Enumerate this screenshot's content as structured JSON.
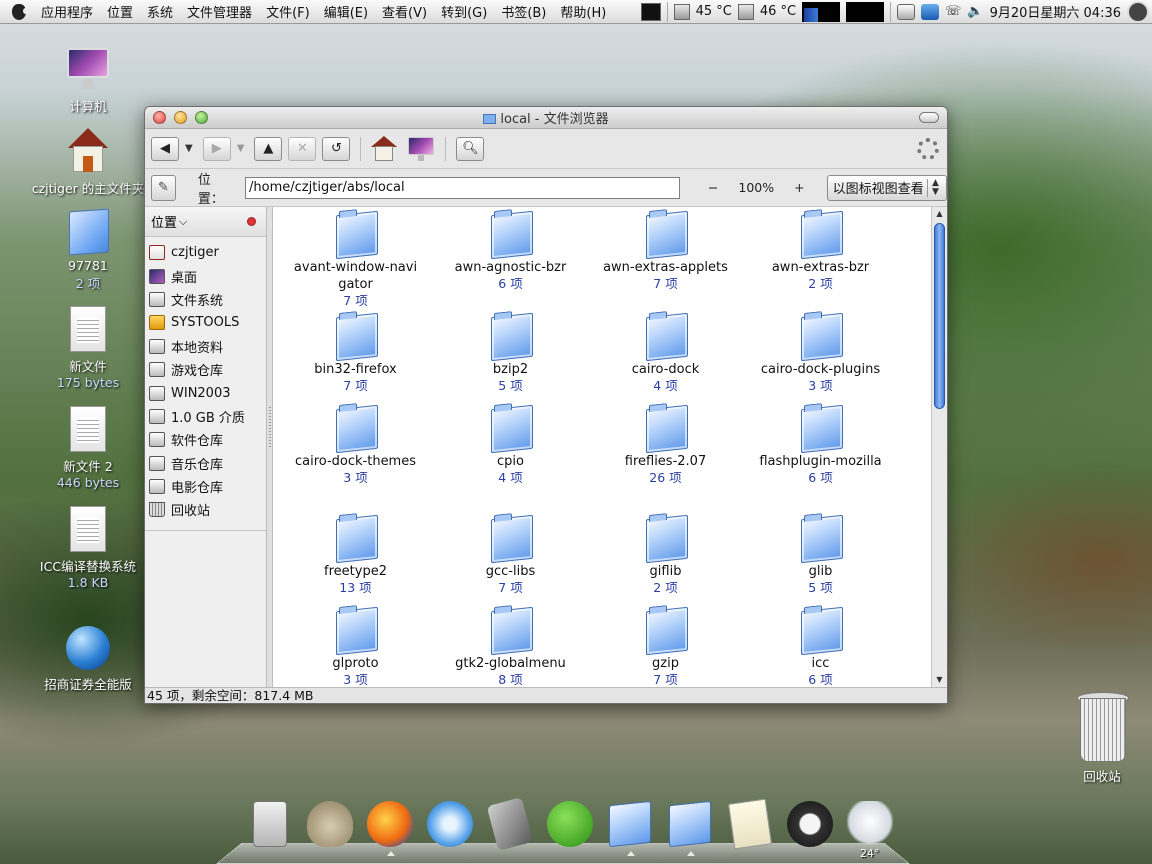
{
  "top_panel": {
    "menus": [
      "应用程序",
      "位置",
      "系统"
    ],
    "file_manager_menus": [
      "文件管理器",
      "文件(F)",
      "编辑(E)",
      "查看(V)",
      "转到(G)",
      "书签(B)",
      "帮助(H)"
    ],
    "temp1": "45 °C",
    "temp2": "46 °C",
    "clock": "9月20日星期六 04:36"
  },
  "desktop_icons": [
    {
      "label": "计算机",
      "sub": ""
    },
    {
      "label": "czjtiger 的主文件夹",
      "sub": ""
    },
    {
      "label": "97781",
      "sub": "2 项"
    },
    {
      "label": "新文件",
      "sub": "175 bytes"
    },
    {
      "label": "新文件 2",
      "sub": "446 bytes"
    },
    {
      "label": "ICC编译替换系统",
      "sub": "1.8 KB"
    },
    {
      "label": "招商证券全能版",
      "sub": ""
    },
    {
      "label": "回收站",
      "sub": ""
    }
  ],
  "window": {
    "title": "local - 文件浏览器",
    "location_label": "位置：",
    "location_value": "/home/czjtiger/abs/local",
    "zoom_minus": "−",
    "zoom_level": "100%",
    "zoom_plus": "+",
    "view_mode": "以图标视图查看",
    "sidebar_header": "位置",
    "sidebar_items": [
      {
        "label": "czjtiger",
        "icon": "home"
      },
      {
        "label": "桌面",
        "icon": "desk"
      },
      {
        "label": "文件系统",
        "icon": "drive"
      },
      {
        "label": "SYSTOOLS",
        "icon": "sys"
      },
      {
        "label": "本地资料",
        "icon": "drive"
      },
      {
        "label": "游戏仓库",
        "icon": "drive"
      },
      {
        "label": "WIN2003",
        "icon": "drive"
      },
      {
        "label": "1.0 GB 介质",
        "icon": "drive"
      },
      {
        "label": "软件仓库",
        "icon": "drive"
      },
      {
        "label": "音乐仓库",
        "icon": "drive"
      },
      {
        "label": "电影仓库",
        "icon": "drive"
      },
      {
        "label": "回收站",
        "icon": "trash"
      }
    ],
    "folders": [
      {
        "name": "avant-window-navigator",
        "count": "7 项"
      },
      {
        "name": "awn-agnostic-bzr",
        "count": "6 项"
      },
      {
        "name": "awn-extras-applets",
        "count": "7 项"
      },
      {
        "name": "awn-extras-bzr",
        "count": "2 项"
      },
      {
        "name": "bin32-firefox",
        "count": "7 项"
      },
      {
        "name": "bzip2",
        "count": "5 项"
      },
      {
        "name": "cairo-dock",
        "count": "4 项"
      },
      {
        "name": "cairo-dock-plugins",
        "count": "3 项"
      },
      {
        "name": "cairo-dock-themes",
        "count": "3 项"
      },
      {
        "name": "cpio",
        "count": "4 项"
      },
      {
        "name": "fireflies-2.07",
        "count": "26 项"
      },
      {
        "name": "flashplugin-mozilla",
        "count": "6 项"
      },
      {
        "name": "freetype2",
        "count": "13 项"
      },
      {
        "name": "gcc-libs",
        "count": "7 项"
      },
      {
        "name": "giflib",
        "count": "2 项"
      },
      {
        "name": "glib",
        "count": "5 项"
      },
      {
        "name": "glproto",
        "count": "3 项"
      },
      {
        "name": "gtk2-globalmenu",
        "count": "8 项"
      },
      {
        "name": "gzip",
        "count": "7 项"
      },
      {
        "name": "icc",
        "count": "6 项"
      }
    ],
    "status": "45 项，剩余空间：817.4 MB"
  },
  "dock": {
    "apps": [
      "calculator",
      "gimp",
      "firefox",
      "itunes",
      "video",
      "utorrent",
      "folder",
      "folder",
      "notes",
      "power",
      "weather"
    ],
    "weather_temp": "24°"
  }
}
